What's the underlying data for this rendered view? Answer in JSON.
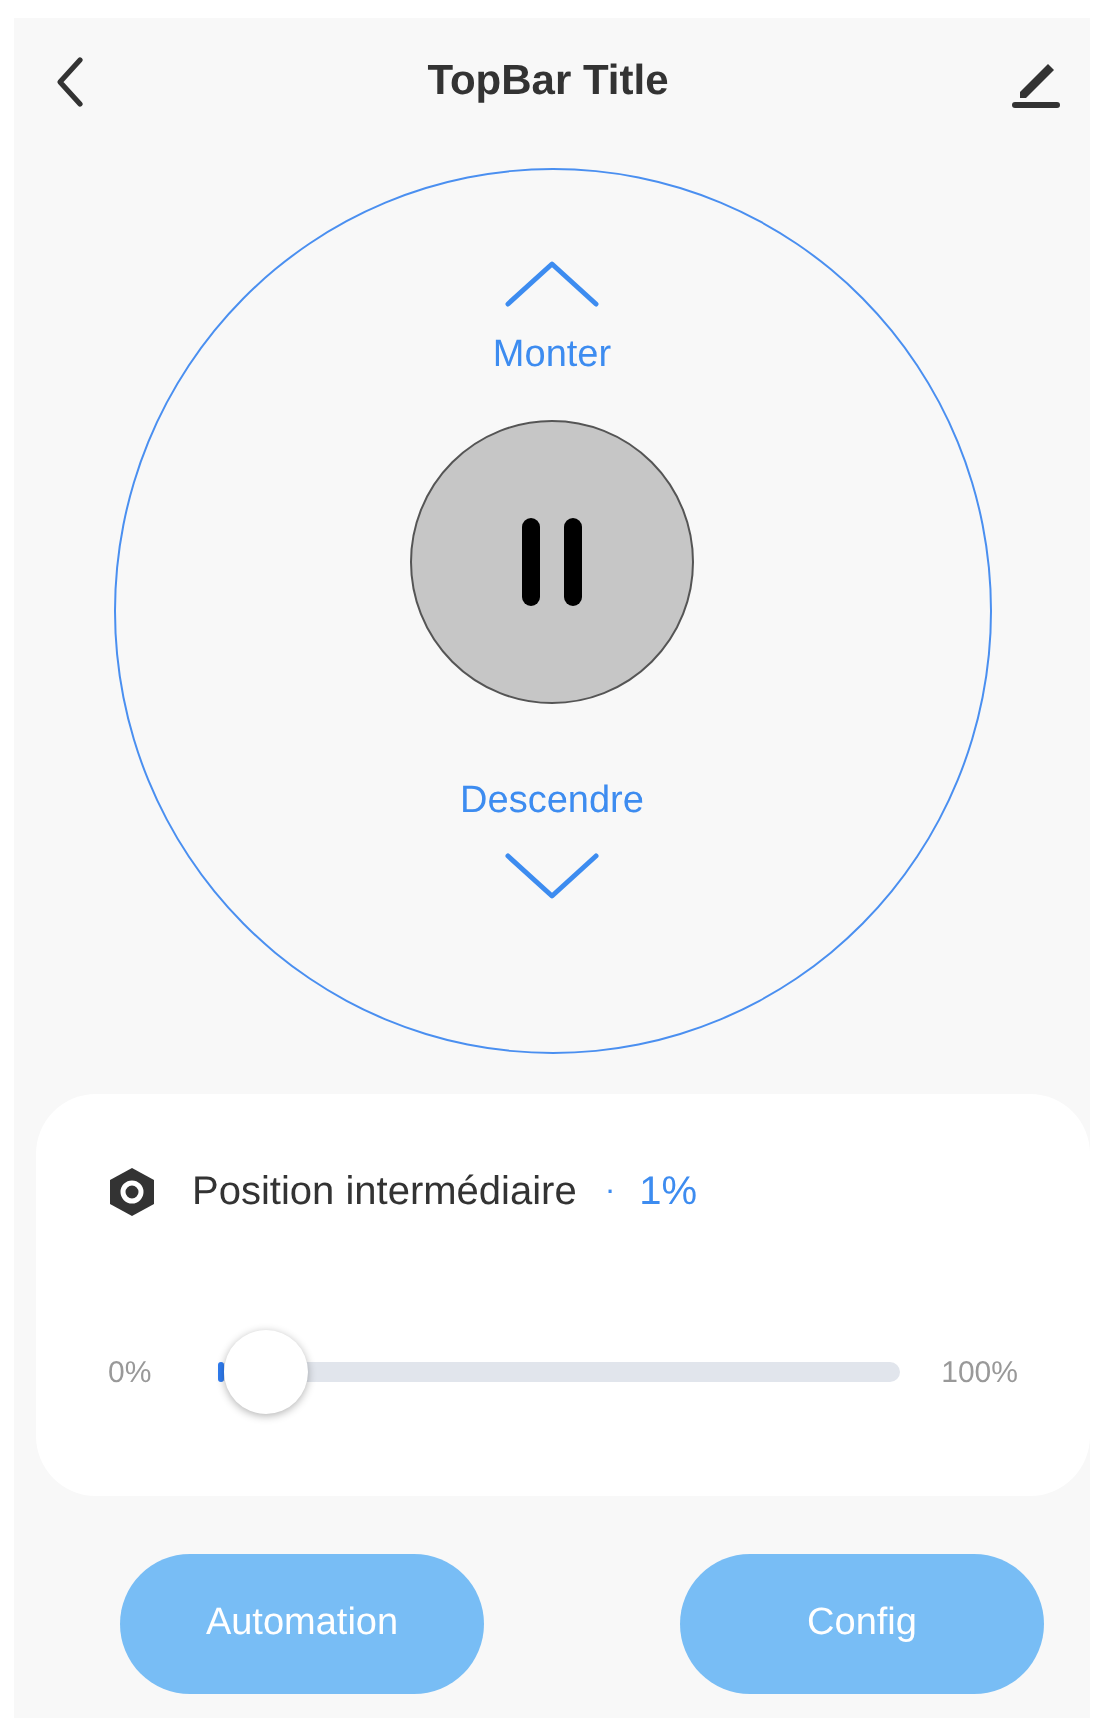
{
  "top_bar": {
    "title": "TopBar Title"
  },
  "control": {
    "up_label": "Monter",
    "down_label": "Descendre"
  },
  "position_card": {
    "label": "Position intermédiaire",
    "separator": "·",
    "value": "1%",
    "min_label": "0%",
    "max_label": "100%",
    "slider": {
      "level": 0.01
    }
  },
  "buttons": [
    "Automation",
    "Config"
  ]
}
